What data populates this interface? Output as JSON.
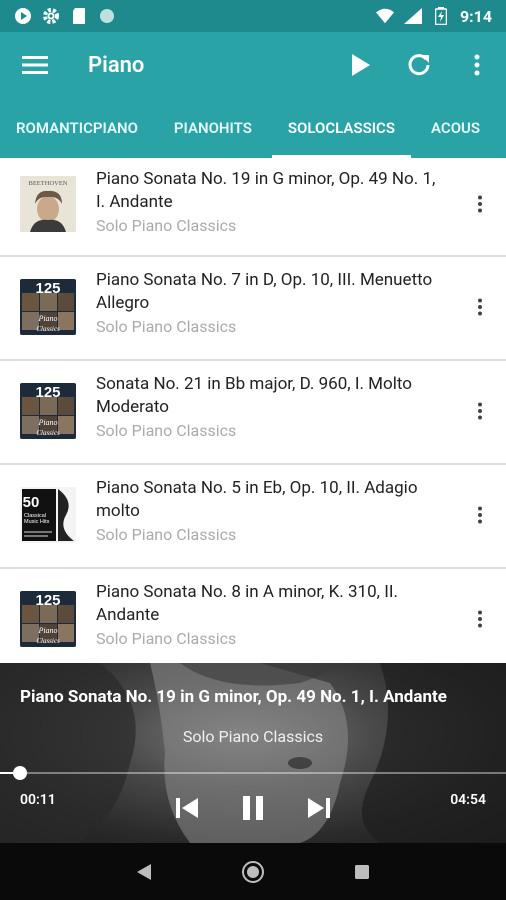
{
  "status": {
    "time": "9:14",
    "colors": {
      "bar": "#1f8a8e"
    }
  },
  "app": {
    "title": "Piano",
    "accent": "#2aa3a7"
  },
  "tabs": [
    {
      "label": "ROMANTICPIANO",
      "active": false
    },
    {
      "label": "PIANOHITS",
      "active": false
    },
    {
      "label": "SOLOCLASSICS",
      "active": true
    },
    {
      "label": "ACOUS",
      "active": false
    }
  ],
  "tracks": [
    {
      "title": "Piano Sonata No. 19 in G minor, Op. 49 No. 1, I. Andante",
      "artist": "Solo Piano Classics",
      "cover": "beethoven"
    },
    {
      "title": "Piano Sonata No. 7 in D, Op. 10, III. Menuetto Allegro",
      "artist": "Solo Piano Classics",
      "cover": "125"
    },
    {
      "title": "Sonata No. 21 in Bb major, D. 960, I. Molto Moderato",
      "artist": "Solo Piano Classics",
      "cover": "125"
    },
    {
      "title": "Piano Sonata No. 5 in Eb, Op. 10, II. Adagio molto",
      "artist": "Solo Piano Classics",
      "cover": "50"
    },
    {
      "title": "Piano Sonata No. 8 in A minor, K. 310, II. Andante",
      "artist": "Solo Piano Classics",
      "cover": "125"
    }
  ],
  "cover_text": {
    "beethoven": "BEETHOVEN",
    "n125": "125",
    "n125_sub": "Essential Piano Classics",
    "n50": "50",
    "n50_sub": "Classical Music Hits"
  },
  "player": {
    "title": "Piano Sonata No. 19 in G minor, Op. 49 No. 1, I. Andante",
    "artist": "Solo Piano Classics",
    "current": "00:11",
    "total": "04:54",
    "progress": 0.04
  }
}
